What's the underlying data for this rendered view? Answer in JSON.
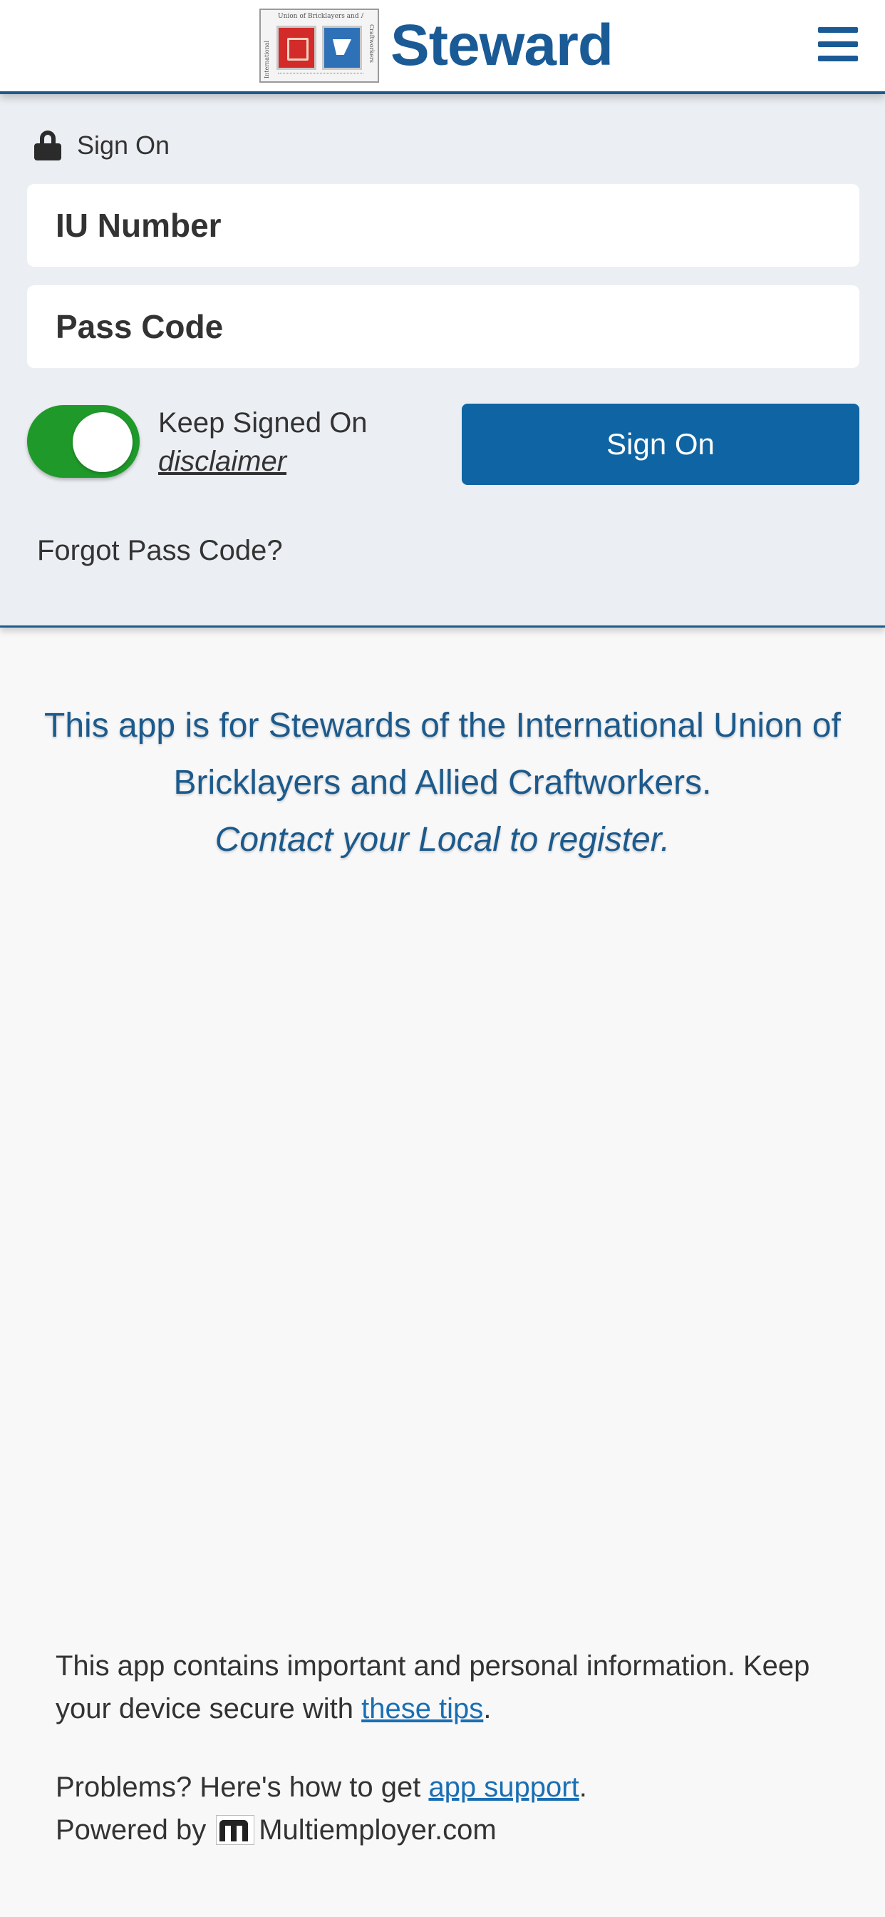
{
  "header": {
    "brand": "Steward",
    "logo": {
      "top_text": "Union of Bricklayers and Allied",
      "left_text": "International",
      "right_text": "Craftworkers",
      "icon": "bac-union-seal"
    },
    "menu_icon": "hamburger-menu-icon"
  },
  "signon": {
    "heading": "Sign On",
    "lock_icon": "lock-icon",
    "iu_placeholder": "IU Number",
    "pass_placeholder": "Pass Code",
    "keep_signed_label": "Keep Signed On",
    "keep_signed_on": true,
    "disclaimer_label": "disclaimer",
    "button_label": "Sign On",
    "forgot_label": "Forgot Pass Code?"
  },
  "info": {
    "line1": "This app is for Stewards of the International Union of Bricklayers and Allied Craftworkers.",
    "line2": "Contact your Local to register."
  },
  "footer": {
    "security_text": "This app contains important and personal information. Keep your device secure with ",
    "tips_link": "these tips",
    "period": ".",
    "problems_text": "Problems? Here's how to get ",
    "support_link": "app support",
    "powered_by": "Powered by",
    "powered_brand": "Multiemployer.com"
  },
  "colors": {
    "brand_blue": "#1a5b96",
    "button_blue": "#0f65a3",
    "toggle_green": "#1f9a2a",
    "link_blue": "#1a6fb3"
  }
}
